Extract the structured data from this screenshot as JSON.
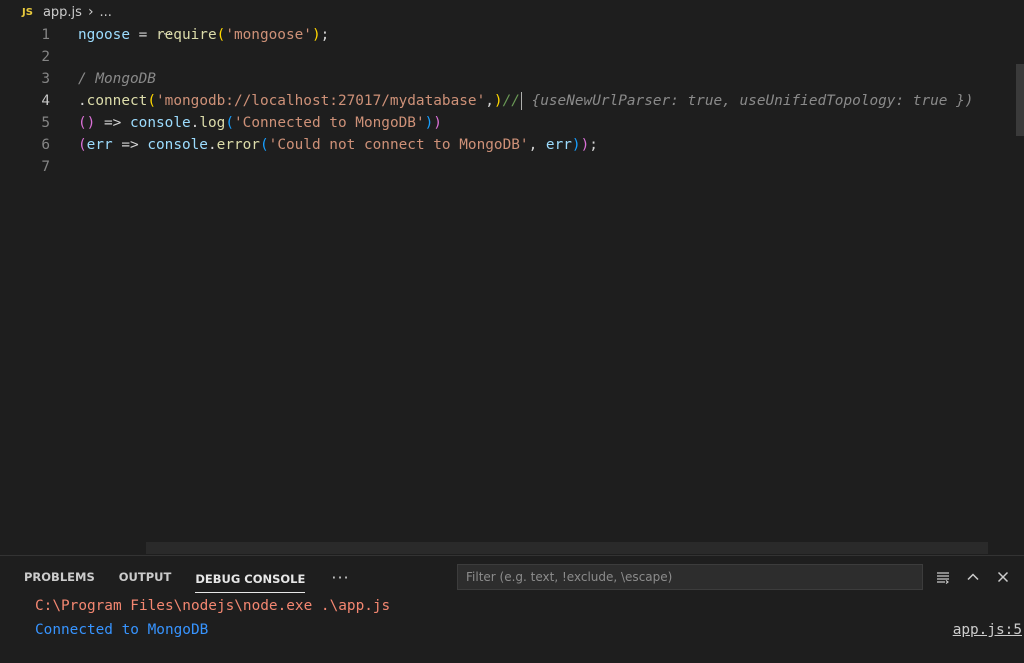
{
  "breadcrumb": {
    "lang_badge": "JS",
    "file": "app.js",
    "separator": "›",
    "more": "..."
  },
  "editor": {
    "lines": [
      {
        "n": "1",
        "parts": [
          {
            "t": "ngoose",
            "c": "c-var"
          },
          {
            "t": " = ",
            "c": "c-def"
          },
          {
            "t": "require",
            "c": "c-fn"
          },
          {
            "t": "(",
            "c": "c-gold"
          },
          {
            "t": "'mongoose'",
            "c": "c-str"
          },
          {
            "t": ")",
            "c": "c-gold"
          },
          {
            "t": ";",
            "c": "c-def"
          }
        ]
      },
      {
        "n": "2",
        "parts": []
      },
      {
        "n": "3",
        "parts": [
          {
            "t": "/ MongoDB",
            "c": "c-ghost"
          }
        ]
      },
      {
        "n": "4",
        "active": true,
        "parts": [
          {
            "t": ".",
            "c": "c-def"
          },
          {
            "t": "connect",
            "c": "c-fn"
          },
          {
            "t": "(",
            "c": "c-gold"
          },
          {
            "t": "'mongodb://localhost:27017/mydatabase'",
            "c": "c-str"
          },
          {
            "t": ",",
            "c": "c-def"
          },
          {
            "t": ")",
            "c": "c-gold"
          },
          {
            "t": "//",
            "c": "c-cmt"
          },
          {
            "cursor": true
          },
          {
            "t": " {useNewUrlParser: true, useUnifiedTopology: true })",
            "c": "c-ghost"
          }
        ]
      },
      {
        "n": "5",
        "parts": [
          {
            "t": "(",
            "c": "c-pink"
          },
          {
            "t": ")",
            "c": "c-pink"
          },
          {
            "t": " => ",
            "c": "c-def"
          },
          {
            "t": "console",
            "c": "c-var"
          },
          {
            "t": ".",
            "c": "c-def"
          },
          {
            "t": "log",
            "c": "c-fn"
          },
          {
            "t": "(",
            "c": "c-blue"
          },
          {
            "t": "'Connected to MongoDB'",
            "c": "c-str"
          },
          {
            "t": ")",
            "c": "c-blue"
          },
          {
            "t": ")",
            "c": "c-pink"
          }
        ]
      },
      {
        "n": "6",
        "parts": [
          {
            "t": "(",
            "c": "c-pink"
          },
          {
            "t": "err",
            "c": "c-var"
          },
          {
            "t": " => ",
            "c": "c-def"
          },
          {
            "t": "console",
            "c": "c-var"
          },
          {
            "t": ".",
            "c": "c-def"
          },
          {
            "t": "error",
            "c": "c-fn"
          },
          {
            "t": "(",
            "c": "c-blue"
          },
          {
            "t": "'Could not connect to MongoDB'",
            "c": "c-str"
          },
          {
            "t": ", ",
            "c": "c-def"
          },
          {
            "t": "err",
            "c": "c-var"
          },
          {
            "t": ")",
            "c": "c-blue"
          },
          {
            "t": ")",
            "c": "c-pink"
          },
          {
            "t": ";",
            "c": "c-def"
          }
        ]
      },
      {
        "n": "7",
        "parts": []
      }
    ]
  },
  "panel": {
    "tabs": [
      {
        "label": "PROBLEMS",
        "active": false
      },
      {
        "label": "OUTPUT",
        "active": false
      },
      {
        "label": "DEBUG CONSOLE",
        "active": true
      }
    ],
    "more_icon": "ellipsis-icon",
    "filter_placeholder": "Filter (e.g. text, !exclude, \\escape)",
    "output": {
      "command": "C:\\Program Files\\nodejs\\node.exe .\\app.js",
      "message": "Connected to MongoDB",
      "source_link": "app.js:5"
    }
  },
  "colors": {
    "background": "#1e1e1e",
    "string": "#ce9178",
    "function": "#dcdcaa",
    "variable": "#9cdcfe",
    "output_command": "#f48771",
    "output_message": "#3794ff"
  }
}
